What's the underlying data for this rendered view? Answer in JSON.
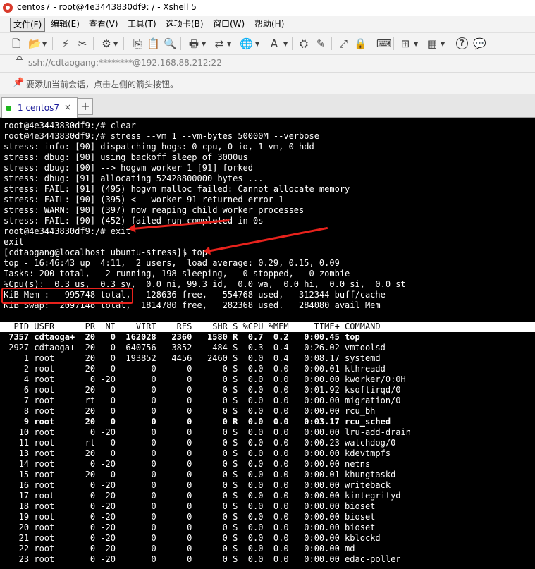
{
  "window": {
    "title": "centos7 - root@4e3443830df9: / - Xshell 5"
  },
  "menu": [
    {
      "label": "文件(F)",
      "active": true
    },
    {
      "label": "编辑(E)"
    },
    {
      "label": "查看(V)"
    },
    {
      "label": "工具(T)"
    },
    {
      "label": "选项卡(B)"
    },
    {
      "label": "窗口(W)"
    },
    {
      "label": "帮助(H)"
    }
  ],
  "toolbar": {
    "icons": [
      "new-session-icon",
      "open-folder-icon",
      "reconnect-icon",
      "disconnect-icon",
      "properties-icon",
      "copy-icon",
      "paste-icon",
      "find-icon",
      "print-icon",
      "transfer-icon",
      "globe-icon",
      "font-icon",
      "xftp-icon",
      "xmanager-icon",
      "fullscreen-icon",
      "lock-screen-icon",
      "keyboard-icon",
      "add-panel-icon",
      "layout-icon",
      "help-icon",
      "chat-icon"
    ],
    "glyphs": {
      "new": "🗋",
      "open": "📂",
      "reconnect": "⚡",
      "disconnect": "✂",
      "properties": "⚙",
      "copy": "⎘",
      "paste": "📋",
      "find": "🔍",
      "print": "🖶",
      "transfer": "⇄",
      "globe": "🌐",
      "font": "A",
      "xftp": "⛭",
      "xmanager": "✎",
      "fullscreen": "⤢",
      "lock": "🔒",
      "keyboard": "⌨",
      "add": "⊞",
      "layout": "▦",
      "help": "?",
      "chat": "💬"
    }
  },
  "address": {
    "text": "ssh://cdtaogang:********@192.168.88.212:22"
  },
  "hint": {
    "text": "要添加当前会话，点击左侧的箭头按钮。"
  },
  "tabs": [
    {
      "label": "1 centos7",
      "close": "×"
    }
  ],
  "tab_add": "+",
  "colors": {
    "terminal_bg": "#000000",
    "terminal_fg": "#ffffff",
    "annotation": "#e8221c",
    "tab_status": "#1db71d"
  },
  "terminal": {
    "lines": [
      "root@4e3443830df9:/# clear",
      "root@4e3443830df9:/# stress --vm 1 --vm-bytes 50000M --verbose",
      "stress: info: [90] dispatching hogs: 0 cpu, 0 io, 1 vm, 0 hdd",
      "stress: dbug: [90] using backoff sleep of 3000us",
      "stress: dbug: [90] --> hogvm worker 1 [91] forked",
      "stress: dbug: [91] allocating 52428800000 bytes ...",
      "stress: FAIL: [91] (495) hogvm malloc failed: Cannot allocate memory",
      "stress: FAIL: [90] (395) <-- worker 91 returned error 1",
      "stress: WARN: [90] (397) now reaping child worker processes",
      "stress: FAIL: [90] (452) failed run completed in 0s",
      "root@4e3443830df9:/# exit",
      "exit",
      "[cdtaogang@localhost ubuntu-stress]$ top",
      "top - 16:46:43 up  4:11,  2 users,  load average: 0.29, 0.15, 0.09",
      "Tasks: 200 total,   2 running, 198 sleeping,   0 stopped,   0 zombie",
      "%Cpu(s):  0.3 us,  0.3 sy,  0.0 ni, 99.3 id,  0.0 wa,  0.0 hi,  0.0 si,  0.0 st",
      "KiB Mem :   995748 total,   128636 free,   554768 used,   312344 buff/cache",
      "KiB Swap:  2097148 total,  1814780 free,   282368 used.   284080 avail Mem",
      ""
    ],
    "process_header": "  PID USER      PR  NI    VIRT    RES    SHR S %CPU %MEM     TIME+ COMMAND",
    "processes": [
      {
        "text": " 7357 cdtaoga+  20   0  162028   2360   1580 R  0.7  0.2   0:00.45 top",
        "bold": true
      },
      {
        "text": " 2927 cdtaoga+  20   0  640756   3852    484 S  0.3  0.4   0:26.02 vmtoolsd"
      },
      {
        "text": "    1 root      20   0  193852   4456   2460 S  0.0  0.4   0:08.17 systemd"
      },
      {
        "text": "    2 root      20   0       0      0      0 S  0.0  0.0   0:00.01 kthreadd"
      },
      {
        "text": "    4 root       0 -20       0      0      0 S  0.0  0.0   0:00.00 kworker/0:0H"
      },
      {
        "text": "    6 root      20   0       0      0      0 S  0.0  0.0   0:01.92 ksoftirqd/0"
      },
      {
        "text": "    7 root      rt   0       0      0      0 S  0.0  0.0   0:00.00 migration/0"
      },
      {
        "text": "    8 root      20   0       0      0      0 S  0.0  0.0   0:00.00 rcu_bh"
      },
      {
        "text": "    9 root      20   0       0      0      0 R  0.0  0.0   0:03.17 rcu_sched",
        "bold": true
      },
      {
        "text": "   10 root       0 -20       0      0      0 S  0.0  0.0   0:00.00 lru-add-drain"
      },
      {
        "text": "   11 root      rt   0       0      0      0 S  0.0  0.0   0:00.23 watchdog/0"
      },
      {
        "text": "   13 root      20   0       0      0      0 S  0.0  0.0   0:00.00 kdevtmpfs"
      },
      {
        "text": "   14 root       0 -20       0      0      0 S  0.0  0.0   0:00.00 netns"
      },
      {
        "text": "   15 root      20   0       0      0      0 S  0.0  0.0   0:00.01 khungtaskd"
      },
      {
        "text": "   16 root       0 -20       0      0      0 S  0.0  0.0   0:00.00 writeback"
      },
      {
        "text": "   17 root       0 -20       0      0      0 S  0.0  0.0   0:00.00 kintegrityd"
      },
      {
        "text": "   18 root       0 -20       0      0      0 S  0.0  0.0   0:00.00 bioset"
      },
      {
        "text": "   19 root       0 -20       0      0      0 S  0.0  0.0   0:00.00 bioset"
      },
      {
        "text": "   20 root       0 -20       0      0      0 S  0.0  0.0   0:00.00 bioset"
      },
      {
        "text": "   21 root       0 -20       0      0      0 S  0.0  0.0   0:00.00 kblockd"
      },
      {
        "text": "   22 root       0 -20       0      0      0 S  0.0  0.0   0:00.00 md"
      },
      {
        "text": "   23 root       0 -20       0      0      0 S  0.0  0.0   0:00.00 edac-poller"
      }
    ]
  }
}
